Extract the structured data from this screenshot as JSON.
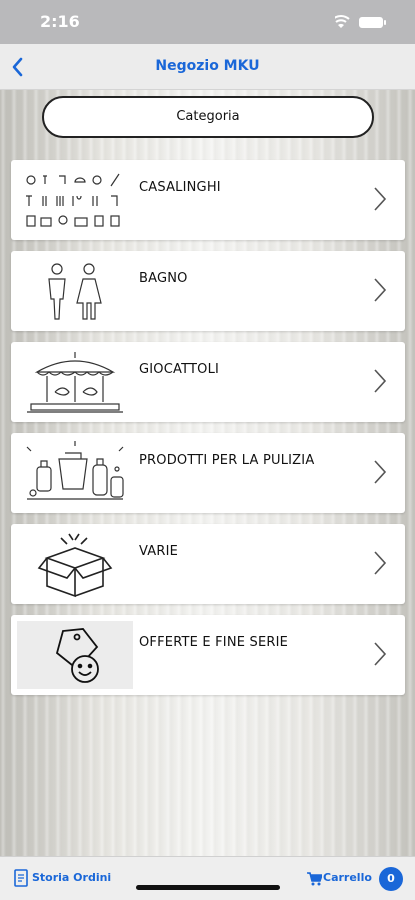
{
  "status_bar": {
    "time": "2:16"
  },
  "nav": {
    "title": "Negozio MKU",
    "back_icon": "chevron-left-icon"
  },
  "header_pill": {
    "label": "Categoria"
  },
  "categories": [
    {
      "label": "CASALINGHI",
      "icon": "kitchen-tools-icon"
    },
    {
      "label": "BAGNO",
      "icon": "restroom-icon"
    },
    {
      "label": "GIOCATTOLI",
      "icon": "carousel-icon"
    },
    {
      "label": "PRODOTTI PER LA PULIZIA",
      "icon": "cleaning-products-icon"
    },
    {
      "label": "VARIE",
      "icon": "open-box-icon"
    },
    {
      "label": "OFFERTE E FINE SERIE",
      "icon": "tag-smile-icon"
    }
  ],
  "bottom_bar": {
    "orders_label": "Storia Ordini",
    "cart_label": "Carrello",
    "cart_count": "0"
  },
  "colors": {
    "accent": "#1a67d8",
    "status_bar": "#b9b9bb"
  }
}
